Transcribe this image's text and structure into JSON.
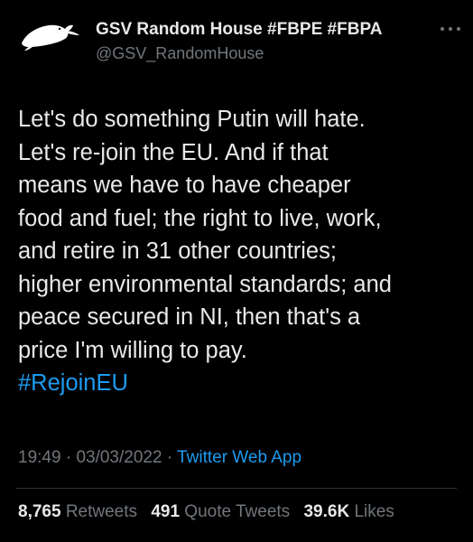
{
  "author": {
    "display_name": "GSV Random House #FBPE #FBPA",
    "handle": "@GSV_RandomHouse",
    "avatar_icon": "seal-avatar-icon"
  },
  "more_icon": "ellipsis-icon",
  "tweet": {
    "lines": [
      "Let's do something Putin will hate.",
      "Let's re-join the EU. And if that",
      "means we have to have cheaper",
      "food and fuel; the right to live, work,",
      "and retire in 31 other countries;",
      "higher environmental standards; and",
      "peace secured in NI, then that's a",
      "price I'm willing to pay."
    ],
    "hashtag": "#RejoinEU"
  },
  "meta": {
    "time": "19:49",
    "separator": " · ",
    "date": "03/03/2022",
    "source": "Twitter Web App"
  },
  "stats": {
    "retweets_count": "8,765",
    "retweets_label": "Retweets",
    "quotes_count": "491",
    "quotes_label": "Quote Tweets",
    "likes_count": "39.6K",
    "likes_label": "Likes"
  },
  "colors": {
    "background": "#000000",
    "text": "#e7e9ea",
    "secondary": "#71767b",
    "accent": "#1d9bf0"
  }
}
